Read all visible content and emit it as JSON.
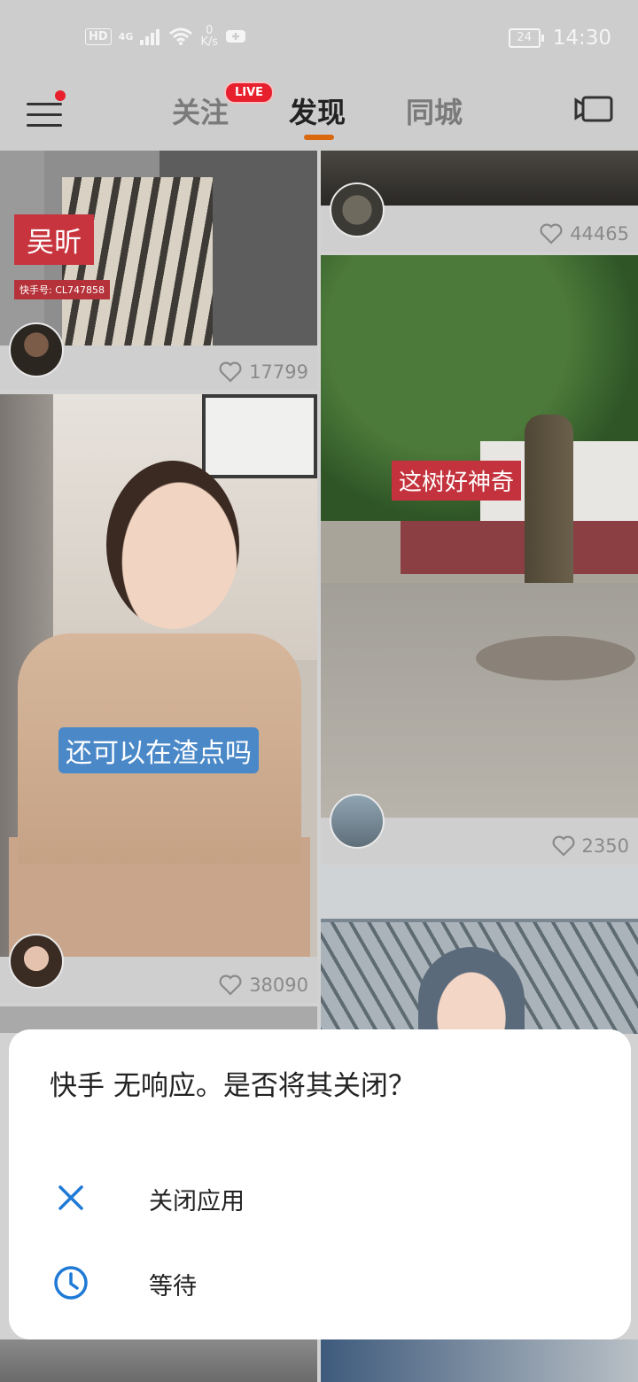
{
  "status_bar": {
    "hd": "HD",
    "network": "4G",
    "speed_value": "0",
    "speed_unit": "K/s",
    "battery": "24",
    "time": "14:30"
  },
  "nav": {
    "tabs": [
      "关注",
      "发现",
      "同城"
    ],
    "active_tab": "发现",
    "live_badge": "LIVE"
  },
  "feed": {
    "left": [
      {
        "caption": "吴昕",
        "subcaption": "快手号: CL747858",
        "likes": "17799"
      },
      {
        "caption": "还可以在渣点吗",
        "likes": "38090"
      }
    ],
    "right": [
      {
        "likes": "44465"
      },
      {
        "caption": "这树好神奇",
        "likes": "2350"
      }
    ]
  },
  "dialog": {
    "title": "快手 无响应。是否将其关闭？",
    "options": [
      {
        "label": "关闭应用",
        "icon": "close-icon"
      },
      {
        "label": "等待",
        "icon": "clock-icon"
      }
    ]
  },
  "colors": {
    "accent": "#d9680f",
    "live": "#e8202d",
    "dialog_icon": "#1f7ad6"
  }
}
